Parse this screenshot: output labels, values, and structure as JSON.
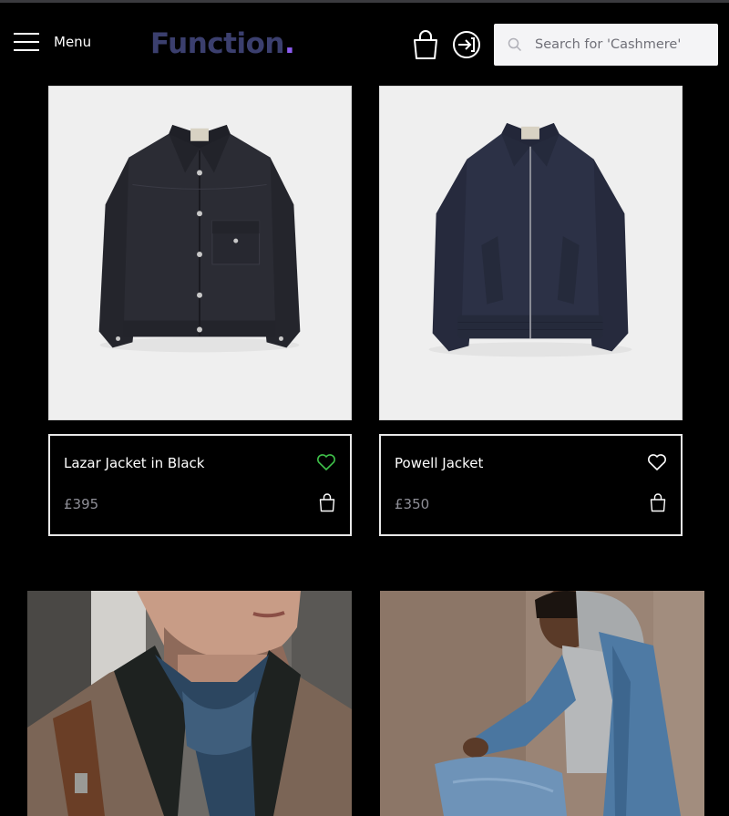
{
  "header": {
    "menu_label": "Menu",
    "logo_text": "Function",
    "logo_dot": ".",
    "search_placeholder": "Search for 'Cashmere'"
  },
  "products": [
    {
      "name": "Lazar Jacket in Black",
      "price": "£395",
      "favorited": true,
      "heart_color": "#3fc24a"
    },
    {
      "name": "Powell Jacket",
      "price": "£350",
      "favorited": false,
      "heart_color": "#ffffff"
    }
  ],
  "icons": {
    "menu": "hamburger-icon",
    "bag": "shopping-bag-icon",
    "login": "login-arrow-icon",
    "search": "magnifier-icon",
    "favorite": "heart-icon"
  },
  "colors": {
    "background": "#000000",
    "logo": "#3b3f6e",
    "logo_accent": "#8c5cf0",
    "price": "#8f8f97",
    "card_border": "#e8e8e8"
  }
}
